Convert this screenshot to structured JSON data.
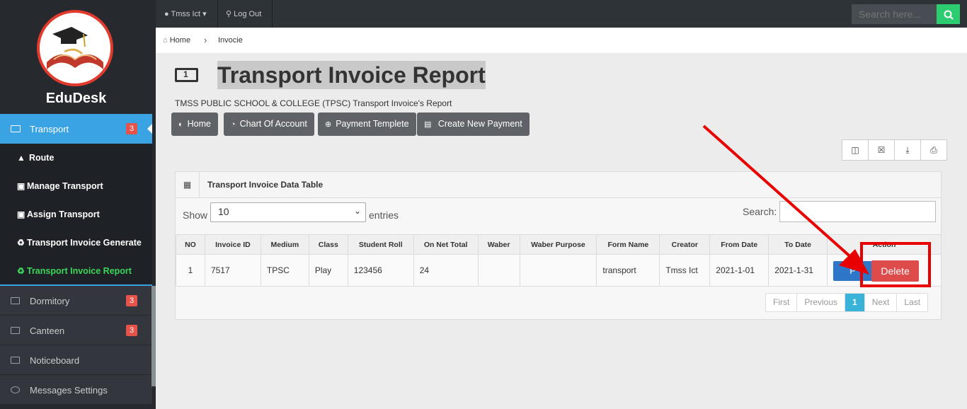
{
  "brand": "EduDesk",
  "sidebar": {
    "active": {
      "label": "Transport",
      "badge": "3"
    },
    "subitems": [
      {
        "label": "Route",
        "icon": "road-icon"
      },
      {
        "label": "Manage Transport",
        "icon": "bus-icon"
      },
      {
        "label": "Assign Transport",
        "icon": "bus-icon"
      },
      {
        "label": "Transport Invoice Generate",
        "icon": "recycle-icon"
      },
      {
        "label": "Transport Invoice Report",
        "icon": "recycle-icon"
      }
    ],
    "items": [
      {
        "label": "Dormitory",
        "badge": "3"
      },
      {
        "label": "Canteen",
        "badge": "3"
      },
      {
        "label": "Noticeboard"
      },
      {
        "label": "Messages Settings"
      }
    ]
  },
  "topbar": {
    "user": "Tmss Ict",
    "logout": "Log Out",
    "search_placeholder": "Search here..."
  },
  "breadcrumb": {
    "home": "Home",
    "current": "Invocie"
  },
  "page": {
    "title": "Transport Invoice Report",
    "subtitle": "TMSS PUBLIC SCHOOL & COLLEGE (TPSC) Transport Invoice's Report"
  },
  "buttons": {
    "home": "Home",
    "chart": "Chart Of Account",
    "template": "Payment Templete",
    "new_payment": "Create New Payment"
  },
  "table_panel": {
    "title": "Transport Invoice Data Table",
    "show_label": "Show",
    "show_value": "10",
    "entries_label": "entries",
    "search_label": "Search:",
    "columns": [
      "NO",
      "Invoice ID",
      "Medium",
      "Class",
      "Student Roll",
      "On Net Total",
      "Waber",
      "Waber Purpose",
      "Form Name",
      "Creator",
      "From Date",
      "To Date",
      "Action"
    ],
    "rows": [
      {
        "no": "1",
        "invoice_id": "7517",
        "medium": "TPSC",
        "class": "Play",
        "roll": "123456",
        "total": "24",
        "waber": "",
        "waber_purpose": "",
        "form_name": "transport",
        "creator": "Tmss Ict",
        "from": "2021-1-01",
        "to": "2021-1-31"
      }
    ],
    "action_print": "P",
    "action_delete": "Delete"
  },
  "pager": {
    "first": "First",
    "previous": "Previous",
    "current": "1",
    "next": "Next",
    "last": "Last"
  },
  "colors": {
    "accent": "#3aa3e3",
    "danger": "#dd4b4b",
    "annotation": "#e80000",
    "sidebar_bg": "#26292e"
  }
}
